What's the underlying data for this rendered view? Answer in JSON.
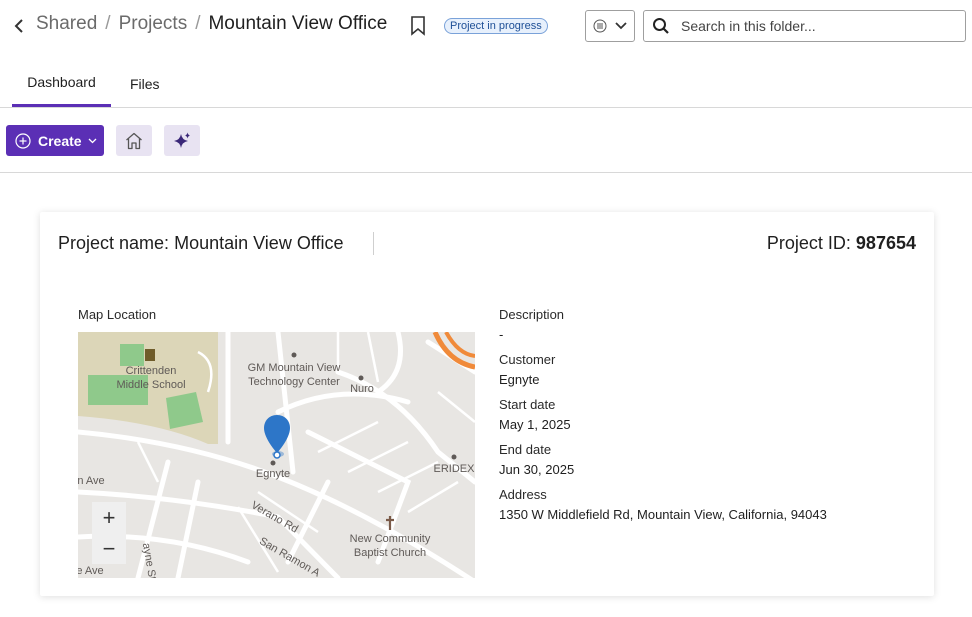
{
  "breadcrumb": {
    "items": [
      "Shared",
      "Projects"
    ],
    "current": "Mountain View Office"
  },
  "status_badge": "Project in progress",
  "search": {
    "placeholder": "Search in this folder..."
  },
  "tabs": [
    {
      "label": "Dashboard",
      "active": true
    },
    {
      "label": "Files",
      "active": false
    }
  ],
  "toolbar": {
    "create_label": "Create"
  },
  "project": {
    "name_label": "Project name:",
    "name_value": "Mountain View Office",
    "id_label": "Project ID:",
    "id_value": "987654"
  },
  "map": {
    "label": "Map Location",
    "place_labels": {
      "school_1": "Crittenden",
      "school_2": "Middle School",
      "center_1": "GM Mountain View",
      "center_2": "Technology Center",
      "nuro": "Nuro",
      "egnyte": "Egnyte",
      "eridex": "ERIDEX",
      "church_1": "New Community",
      "church_2": "Baptist Church",
      "ave_1": "n Ave",
      "verano": "Verano Rd",
      "sanramon": "San Ramon A",
      "ave_2": "e Ave",
      "jayne": "ayne St"
    },
    "zoom_in": "+",
    "zoom_out": "−"
  },
  "details": {
    "description_label": "Description",
    "description_value": "-",
    "customer_label": "Customer",
    "customer_value": "Egnyte",
    "start_label": "Start date",
    "start_value": "May 1, 2025",
    "end_label": "End date",
    "end_value": "Jun 30, 2025",
    "address_label": "Address",
    "address_value": "1350 W Middlefield Rd, Mountain View, California, 94043"
  },
  "colors": {
    "accent": "#5b2fb5",
    "badge_bg": "#e7f0fc",
    "badge_border": "#7aa2d9",
    "pin": "#2d76c8"
  }
}
